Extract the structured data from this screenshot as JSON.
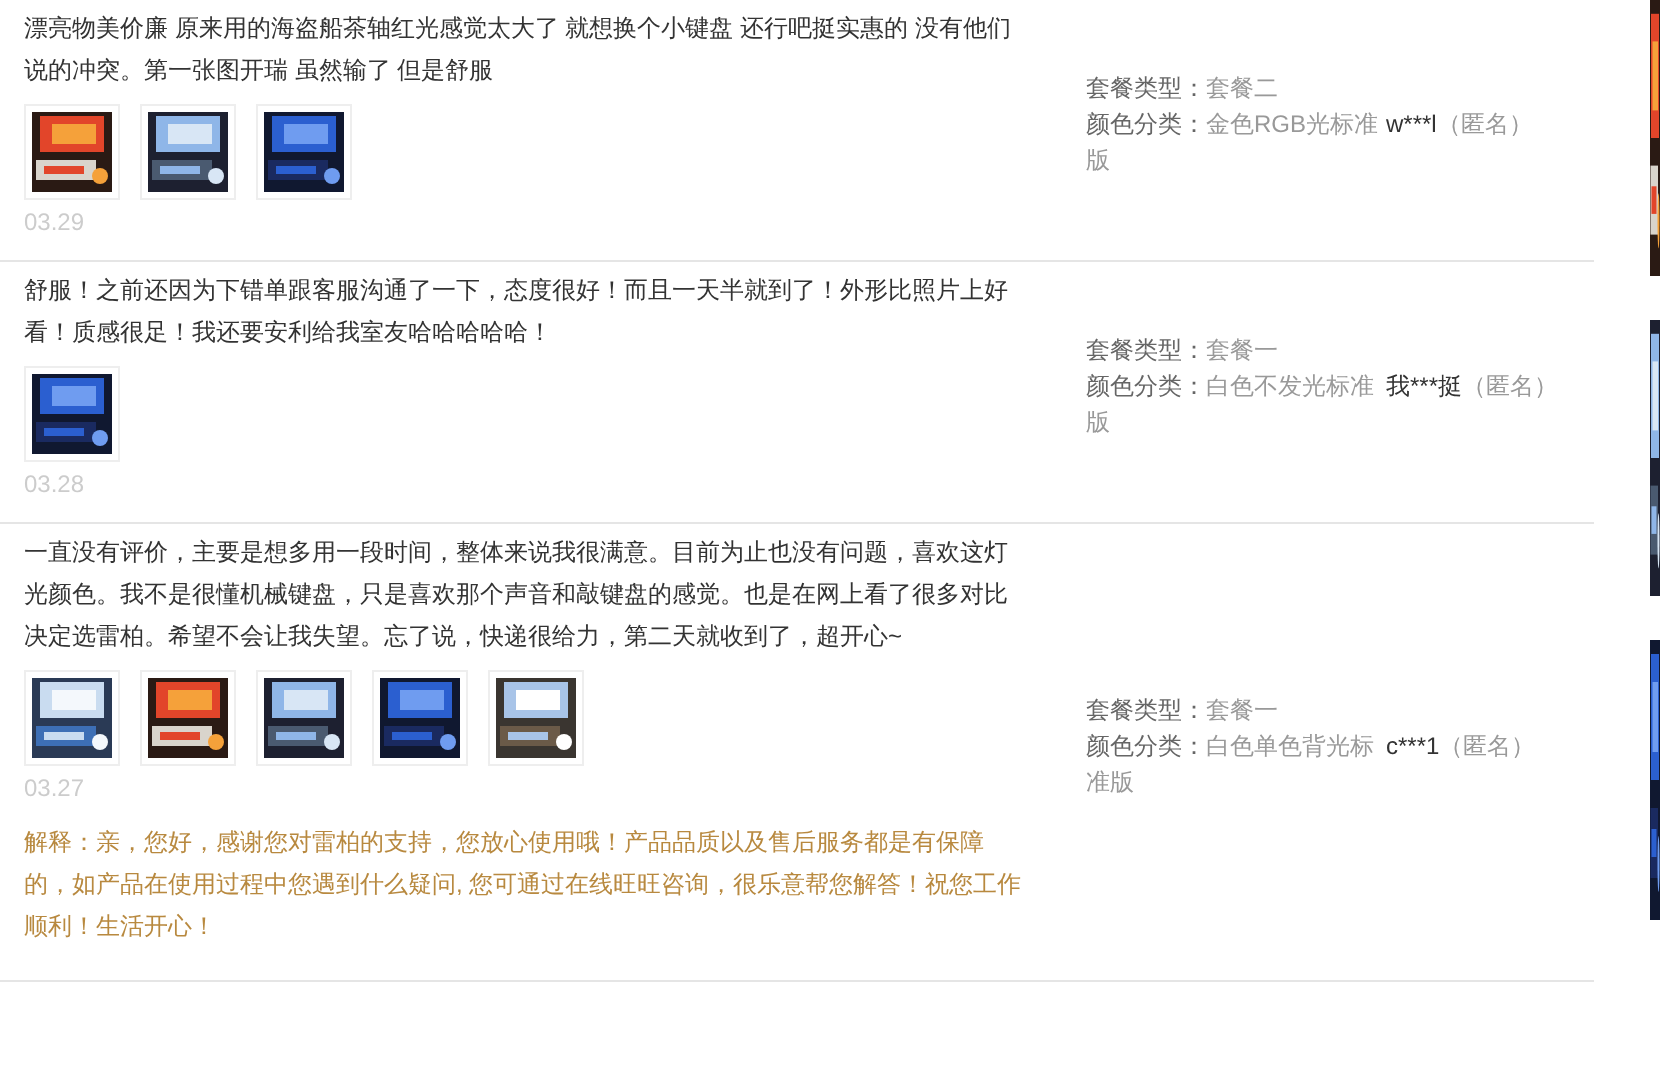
{
  "reviews": [
    {
      "text": "漂亮物美价廉 原来用的海盗船茶轴红光感觉太大了 就想换个小键盘 还行吧挺实惠的 没有他们说的冲突。第一张图开瑞 虽然输了 但是舒服",
      "photos": [
        {
          "kind": "picture"
        },
        {
          "kind": "picture"
        },
        {
          "kind": "picture"
        }
      ],
      "date": "03.29",
      "specs": [
        {
          "label": "套餐类型：",
          "value": "套餐二"
        },
        {
          "label": "颜色分类：",
          "value": "金色RGB光标准版"
        }
      ],
      "user": "w***l",
      "anonymous": "（匿名）"
    },
    {
      "text": "舒服！之前还因为下错单跟客服沟通了一下，态度很好！而且一天半就到了！外形比照片上好看！质感很足！我还要安利给我室友哈哈哈哈哈！",
      "photos": [
        {
          "kind": "picture"
        }
      ],
      "date": "03.28",
      "specs": [
        {
          "label": "套餐类型：",
          "value": "套餐一"
        },
        {
          "label": "颜色分类：",
          "value": "白色不发光标准版"
        }
      ],
      "user": "我***挺",
      "anonymous": "（匿名）"
    },
    {
      "text": "一直没有评价，主要是想多用一段时间，整体来说我很满意。目前为止也没有问题，喜欢这灯光颜色。我不是很懂机械键盘，只是喜欢那个声音和敲键盘的感觉。也是在网上看了很多对比决定选雷柏。希望不会让我失望。忘了说，快递很给力，第二天就收到了，超开心~",
      "photos": [
        {
          "kind": "picture"
        },
        {
          "kind": "picture"
        },
        {
          "kind": "picture"
        },
        {
          "kind": "picture"
        },
        {
          "kind": "picture"
        }
      ],
      "date": "03.27",
      "reply": "解释：亲，您好，感谢您对雷柏的支持，您放心使用哦！产品品质以及售后服务都是有保障的，如产品在使用过程中您遇到什么疑问, 您可通过在线旺旺咨询，很乐意帮您解答！祝您工作顺利！生活开心！",
      "specs": [
        {
          "label": "套餐类型：",
          "value": "套餐一"
        },
        {
          "label": "颜色分类：",
          "value": "白色单色背光标准版"
        }
      ],
      "user": "c***1",
      "anonymous": "（匿名）"
    }
  ]
}
